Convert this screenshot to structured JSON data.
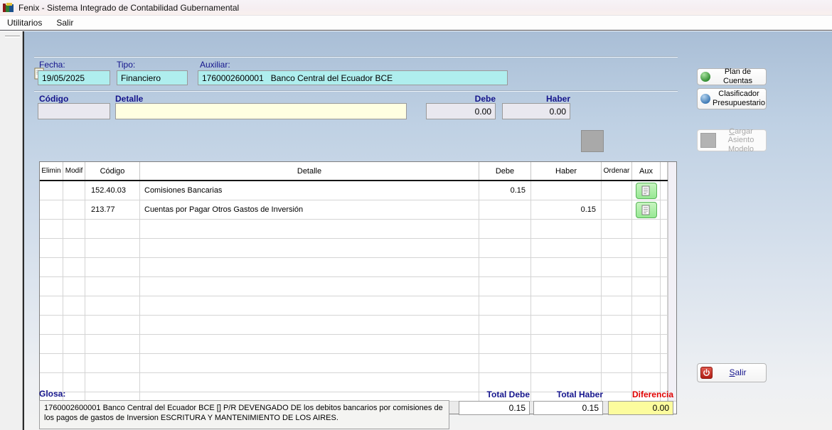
{
  "window": {
    "title": "Fenix - Sistema Integrado de Contabilidad Gubernamental"
  },
  "menu": {
    "items": [
      {
        "label": "Utilitarios"
      },
      {
        "label": "Salir"
      }
    ]
  },
  "form": {
    "fecha_label": "Fecha:",
    "fecha_value": "19/05/2025",
    "tipo_label": "Tipo:",
    "tipo_value": "Financiero",
    "auxiliar_label": "Auxiliar:",
    "auxiliar_value": "1760002600001   Banco Central del Ecuador BCE",
    "codigo_label": "Código",
    "codigo_value": "",
    "detalle_label": "Detalle",
    "detalle_value": "",
    "debe_label": "Debe",
    "debe_value": "0.00",
    "haber_label": "Haber",
    "haber_value": "0.00"
  },
  "table": {
    "columns": [
      "Elimin",
      "Modif",
      "Código",
      "Detalle",
      "Debe",
      "Haber",
      "Ordenar",
      "Aux"
    ],
    "rows": [
      {
        "codigo": "152.40.03",
        "detalle": "Comisiones Bancarias",
        "debe": "0.15",
        "haber": ""
      },
      {
        "codigo": "213.77",
        "detalle": "Cuentas por Pagar Otros Gastos de Inversión",
        "debe": "",
        "haber": "0.15"
      }
    ]
  },
  "side_buttons": {
    "plan_de_cuentas": "Plan de Cuentas",
    "clasificador": "Clasificador Presupuestario",
    "cargar_accel": "C",
    "cargar_rest": "argar Asiento Modelo",
    "salir_accel": "S",
    "salir_rest": "alir"
  },
  "footer": {
    "glosa_label": "Glosa:",
    "glosa_value": "1760002600001 Banco Central del Ecuador BCE  [] P/R DEVENGADO DE  los debitos bancarios por comisiones de los pagos de gastos de Inversion ESCRITURA Y MANTENIMIENTO DE LOS AIRES.",
    "total_debe_label": "Total Debe",
    "total_debe_value": "0.15",
    "total_haber_label": "Total Haber",
    "total_haber_value": "0.15",
    "diferencia_label": "Diferencia",
    "diferencia_value": "0.00"
  },
  "colors": {
    "field_cyan": "#AFEEEE",
    "field_yellow": "#FFFFE1",
    "field_gray": "#E9E8EF",
    "diferencia_yellow": "#FCFC9E",
    "aux_green": "#96E893",
    "label_navy": "#14148C",
    "diferencia_red": "#E00000",
    "power_red": "#B01E14"
  }
}
